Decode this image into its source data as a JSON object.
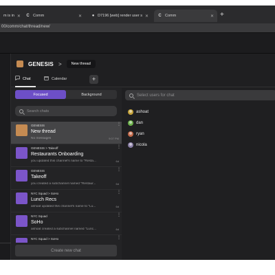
{
  "browser": {
    "tabs": [
      {
        "favicon": "",
        "label": "m is in",
        "active": false
      },
      {
        "favicon": "C",
        "label": "Comm",
        "active": false
      },
      {
        "favicon": "github-icon",
        "label": "D7196 [web] render user s",
        "active": false
      },
      {
        "favicon": "C",
        "label": "Comm",
        "active": true
      }
    ],
    "url": "00/comm/chat/thread/new/"
  },
  "header": {
    "workspace": "GENESIS",
    "breadcrumb_sep": ">",
    "thread_pill": "New thread"
  },
  "subtabs": {
    "chat": "Chat",
    "calendar": "Calendar",
    "add": "+"
  },
  "chat_panel": {
    "segments": {
      "focused": "Focused",
      "background": "Background"
    },
    "search_placeholder": "Search chats",
    "chats": [
      {
        "parent": "GENESIS",
        "title": "New thread",
        "message": "No messages",
        "time": "9:07 PM",
        "color": "#c58b52",
        "selected": true
      },
      {
        "parent": "GENESIS  >  Takeoff",
        "title": "Restaurants Onboarding",
        "message": "you updated this channel's name to \"Resta...",
        "time": "6d",
        "color": "#7b55c9",
        "selected": false
      },
      {
        "parent": "GENESIS",
        "title": "Takeoff",
        "message": "you created a subchannel named \"Restaur...",
        "time": "6d",
        "color": "#7b55c9",
        "selected": false
      },
      {
        "parent": "NYC Squad  >  SoHo",
        "title": "Lunch Recs",
        "message": "ashoat updated this channel's name to \"Lu...",
        "time": "6d",
        "color": "#7b55c9",
        "selected": false
      },
      {
        "parent": "NYC Squad",
        "title": "SoHo",
        "message": "ashoat created a subchannel named \"Lunc...",
        "time": "6d",
        "color": "#7b55c9",
        "selected": false
      },
      {
        "parent": "NYC Squad  >  SoHo",
        "title": "",
        "message": "",
        "time": "",
        "color": "#7b55c9",
        "selected": false
      }
    ],
    "create_button": "Create new chat"
  },
  "user_panel": {
    "search_placeholder": "Select users for chat",
    "users": [
      {
        "name": "ashoat",
        "color": "#c4a23a"
      },
      {
        "name": "dan",
        "color": "#6bb04a"
      },
      {
        "name": "ryan",
        "color": "#c2694a"
      },
      {
        "name": "nicola",
        "color": "#8a7fa6"
      }
    ]
  }
}
